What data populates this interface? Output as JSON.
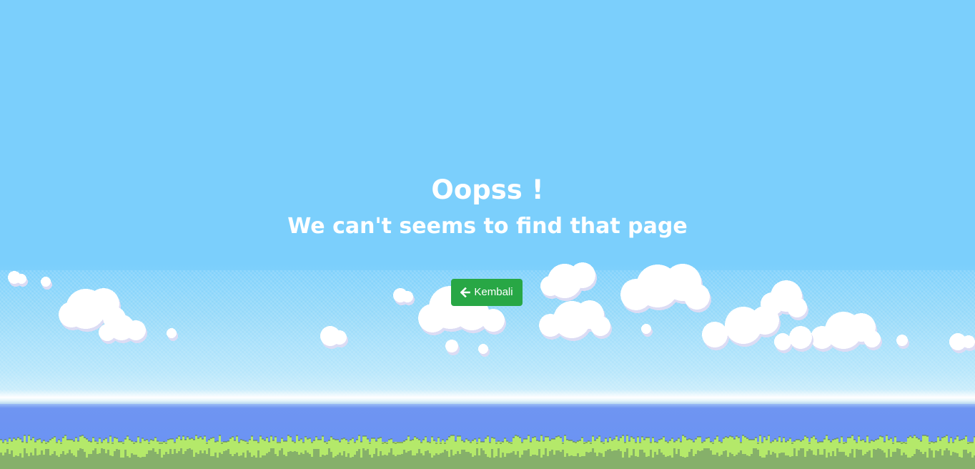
{
  "page": {
    "heading": "Oopss !",
    "message": "We can't seems to find that page",
    "back_button": {
      "label": "Kembali",
      "icon": "arrow-left-icon",
      "color": "#28a745"
    }
  },
  "scene": {
    "sky_color": "#7bcffc",
    "sea_color": "#6b93f3",
    "grass_color": "#b4e96a",
    "grass_shadow_color": "#86b06a",
    "cloud_color": "#ffffff",
    "cloud_shade_color": "#dcdcf4"
  }
}
